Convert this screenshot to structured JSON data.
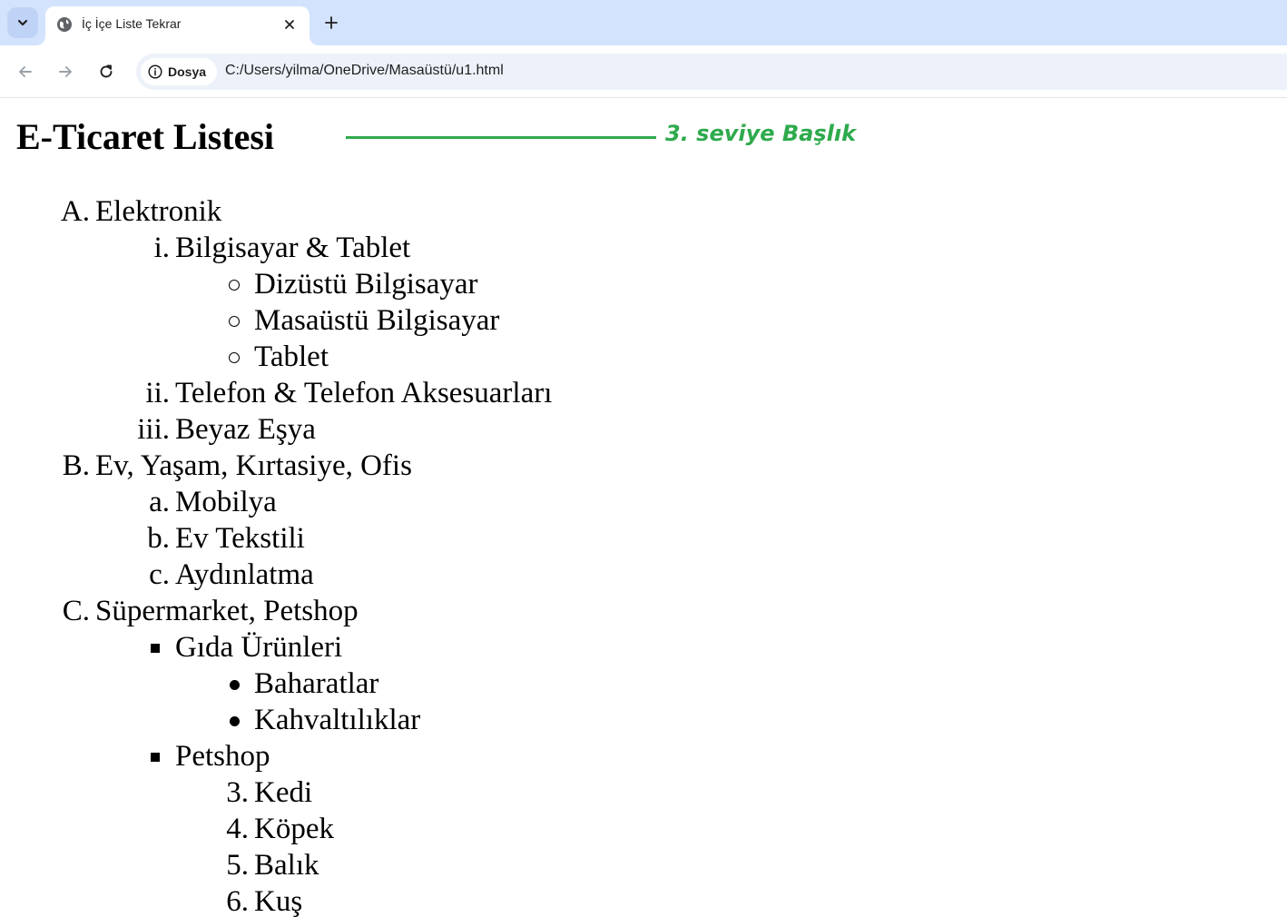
{
  "browser": {
    "tab": {
      "title": "İç İçe Liste Tekrar"
    },
    "address_bar": {
      "chip_label": "Dosya",
      "url": "C:/Users/yilma/OneDrive/Masaüstü/u1.html"
    }
  },
  "page": {
    "title": "E-Ticaret Listesi",
    "annotation": "3. seviye Başlık",
    "annotation_color": "#2eaa4d",
    "list": [
      {
        "marker": "A.",
        "label": "Elektronik",
        "children": [
          {
            "marker": "i.",
            "label": "Bilgisayar & Tablet",
            "children": [
              {
                "bullet": "circle",
                "label": "Dizüstü Bilgisayar"
              },
              {
                "bullet": "circle",
                "label": "Masaüstü Bilgisayar"
              },
              {
                "bullet": "circle",
                "label": "Tablet"
              }
            ]
          },
          {
            "marker": "ii.",
            "label": "Telefon & Telefon Aksesuarları"
          },
          {
            "marker": "iii.",
            "label": "Beyaz Eşya"
          }
        ]
      },
      {
        "marker": "B.",
        "label": "Ev, Yaşam, Kırtasiye, Ofis",
        "children": [
          {
            "marker": "a.",
            "label": "Mobilya"
          },
          {
            "marker": "b.",
            "label": "Ev Tekstili"
          },
          {
            "marker": "c.",
            "label": "Aydınlatma"
          }
        ]
      },
      {
        "marker": "C.",
        "label": "Süpermarket, Petshop",
        "children": [
          {
            "bullet": "square",
            "label": "Gıda Ürünleri",
            "children": [
              {
                "bullet": "disc",
                "label": "Baharatlar"
              },
              {
                "bullet": "disc",
                "label": "Kahvaltılıklar"
              }
            ]
          },
          {
            "bullet": "square",
            "label": "Petshop",
            "children": [
              {
                "marker": "3.",
                "label": "Kedi"
              },
              {
                "marker": "4.",
                "label": "Köpek"
              },
              {
                "marker": "5.",
                "label": "Balık"
              },
              {
                "marker": "6.",
                "label": "Kuş"
              }
            ]
          }
        ]
      }
    ]
  }
}
